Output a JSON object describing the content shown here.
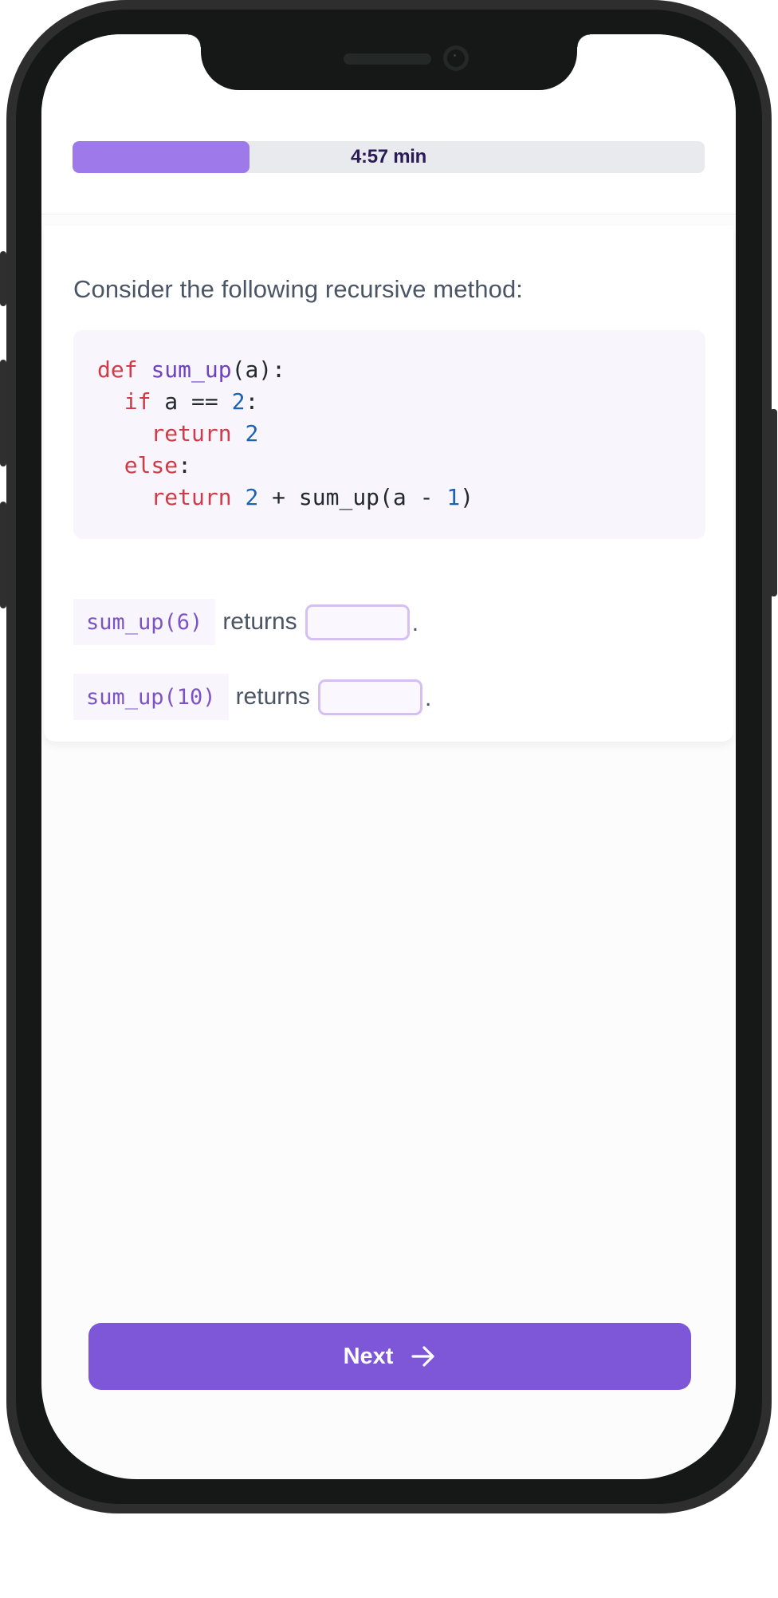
{
  "timer": {
    "label": "4:57 min",
    "progress_fraction": 0.28,
    "fill_color": "#9d79ea",
    "track_color": "#e9eaee"
  },
  "question": {
    "prompt": "Consider the following recursive method:",
    "code_language": "python",
    "code_lines": [
      [
        {
          "t": "def",
          "c": "kw"
        },
        {
          "t": " "
        },
        {
          "t": "sum_up",
          "c": "fn"
        },
        {
          "t": "(a):"
        }
      ],
      [
        {
          "t": "  "
        },
        {
          "t": "if",
          "c": "kw"
        },
        {
          "t": " a == "
        },
        {
          "t": "2",
          "c": "num"
        },
        {
          "t": ":"
        }
      ],
      [
        {
          "t": "    "
        },
        {
          "t": "return",
          "c": "kw"
        },
        {
          "t": " "
        },
        {
          "t": "2",
          "c": "num"
        }
      ],
      [
        {
          "t": "  "
        },
        {
          "t": "else",
          "c": "kw"
        },
        {
          "t": ":"
        }
      ],
      [
        {
          "t": "    "
        },
        {
          "t": "return",
          "c": "kw"
        },
        {
          "t": " "
        },
        {
          "t": "2",
          "c": "num"
        },
        {
          "t": " + sum_up(a - "
        },
        {
          "t": "1",
          "c": "num"
        },
        {
          "t": ")"
        }
      ]
    ]
  },
  "answers": [
    {
      "expression": "sum_up(6)",
      "connector": "returns",
      "value": "",
      "placeholder": "",
      "suffix": "."
    },
    {
      "expression": "sum_up(10)",
      "connector": "returns",
      "value": "",
      "placeholder": "",
      "suffix": "."
    }
  ],
  "footer": {
    "next_label": "Next",
    "next_icon": "arrow-right-icon",
    "accent_color": "#7e57d9"
  }
}
